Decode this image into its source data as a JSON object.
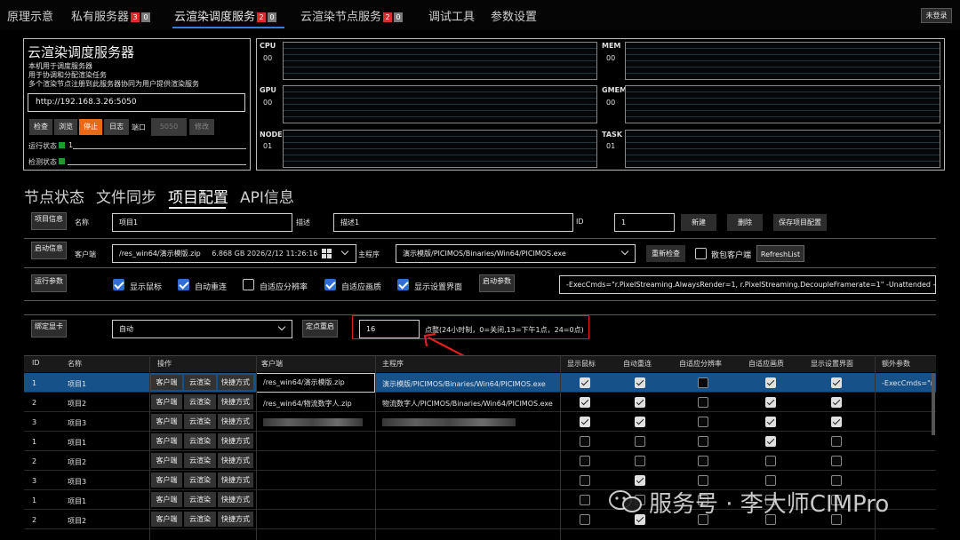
{
  "nav": {
    "items": [
      {
        "label": "原理示意"
      },
      {
        "label": "私有服务器",
        "badge_red": "3",
        "badge_gray": "0"
      },
      {
        "label": "云渲染调度服务",
        "badge_red": "2",
        "badge_gray": "0"
      },
      {
        "label": "云渲染节点服务",
        "badge_red": "2",
        "badge_gray": "0"
      },
      {
        "label": "调试工具"
      },
      {
        "label": "参数设置"
      }
    ],
    "login": "未登录"
  },
  "server": {
    "title": "云渲染调度服务器",
    "desc": [
      "本机用于调度服务器",
      "用于协调和分配渲染任务",
      "多个渲染节点注册到此服务器协同为用户提供渲染服务"
    ],
    "url": "http://192.168.3.26:5050",
    "buttons": [
      "检查",
      "浏览",
      "停止",
      "日志"
    ],
    "port_label": "端口",
    "port_value": "5050",
    "modify": "修改",
    "run_status": "运行状态",
    "run_count": "1",
    "detect_status": "检测状态"
  },
  "monitors": [
    {
      "label": "CPU",
      "value": "00"
    },
    {
      "label": "MEM",
      "value": "00"
    },
    {
      "label": "GPU",
      "value": "00"
    },
    {
      "label": "GMEM",
      "value": "00"
    },
    {
      "label": "NODE",
      "value": "01"
    },
    {
      "label": "TASK",
      "value": "01"
    }
  ],
  "tabs": [
    "节点状态",
    "文件同步",
    "项目配置",
    "API信息"
  ],
  "project_info": {
    "section": "项目信息",
    "name_label": "名称",
    "name_value": "项目1",
    "desc_label": "描述",
    "desc_value": "描述1",
    "id_label": "ID",
    "id_value": "1",
    "btn_new": "新建",
    "btn_delete": "删除",
    "btn_save": "保存项目配置"
  },
  "launch_info": {
    "section": "启动信息",
    "client_label": "客户端",
    "client_value": "/res_win64/演示模版.zip",
    "client_meta": "6.868 GB 2026/2/12 11:26:16",
    "main_label": "主程序",
    "main_value": "演示模版/PICIMOS/Binaries/Win64/PICIMOS.exe",
    "recheck": "重新检查",
    "scatter_label": "散包客户端",
    "refresh": "RefreshList"
  },
  "run_params": {
    "section": "运行参数",
    "checks": [
      {
        "label": "显示鼠标",
        "checked": true
      },
      {
        "label": "自动重连",
        "checked": true
      },
      {
        "label": "自适应分辨率",
        "checked": false
      },
      {
        "label": "自适应画质",
        "checked": true
      },
      {
        "label": "显示设置界面",
        "checked": true
      }
    ],
    "launch_params_btn": "启动参数",
    "launch_params_value": "-ExecCmds=\"r.PixelStreaming.AlwaysRender=1, r.PixelStreaming.DecoupleFramerate=1\" -Unattended -PixelSt"
  },
  "gpu": {
    "section": "绑定显卡",
    "value": "自动",
    "restart_btn": "定点重启",
    "hour_value": "16",
    "hint": "点整(24小时制，0=关闭,13=下午1点，24=0点)"
  },
  "table": {
    "headers": [
      "ID",
      "名称",
      "操作",
      "客户端",
      "主程序",
      "显示鼠标",
      "自动重连",
      "自适应分辨率",
      "自适应画质",
      "显示设置界面",
      "额外参数"
    ],
    "op_buttons": [
      "客户端",
      "云渲染",
      "快捷方式"
    ],
    "rows": [
      {
        "id": "1",
        "name": "项目1",
        "client": "/res_win64/演示模版.zip",
        "main": "演示模版/PICIMOS/Binaries/Win64/PICIMOS.exe",
        "checks": [
          true,
          true,
          false,
          true,
          true
        ],
        "extra": "-ExecCmds=\"r.P"
      },
      {
        "id": "2",
        "name": "项目2",
        "client": "/res_win64/物流数字人.zip",
        "main": "物流数字人/PICIMOS/Binaries/Win64/PICIMOS.exe",
        "checks": [
          true,
          true,
          false,
          true,
          true
        ],
        "extra": ""
      },
      {
        "id": "3",
        "name": "项目3",
        "client": "",
        "main": "",
        "checks": [
          true,
          true,
          false,
          true,
          true
        ],
        "extra": ""
      },
      {
        "id": "1",
        "name": "项目1",
        "client": "",
        "main": "",
        "checks": [
          false,
          false,
          false,
          true,
          false
        ],
        "extra": ""
      },
      {
        "id": "2",
        "name": "项目2",
        "client": "",
        "main": "",
        "checks": [
          false,
          false,
          false,
          false,
          false
        ],
        "extra": ""
      },
      {
        "id": "3",
        "name": "项目3",
        "client": "",
        "main": "",
        "checks": [
          false,
          true,
          false,
          false,
          false
        ],
        "extra": ""
      },
      {
        "id": "1",
        "name": "项目1",
        "client": "",
        "main": "",
        "checks": [
          false,
          false,
          false,
          false,
          false
        ],
        "extra": ""
      },
      {
        "id": "2",
        "name": "项目2",
        "client": "",
        "main": "",
        "checks": [
          false,
          true,
          false,
          false,
          false
        ],
        "extra": ""
      }
    ]
  },
  "watermark": "服务号 · 李大师CIMPro"
}
